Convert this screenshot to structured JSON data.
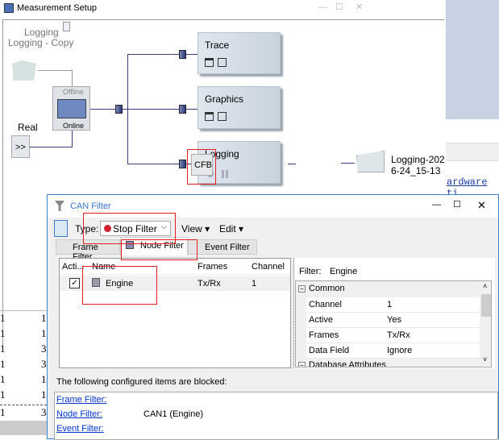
{
  "main_window": {
    "title": "Measurement Setup",
    "controls": [
      "—",
      "☐",
      "✕"
    ]
  },
  "diagram": {
    "source_labels": [
      "Logging",
      "Logging - Copy"
    ],
    "switch": {
      "top": "Offline",
      "bottom": "Online"
    },
    "real": {
      "label": "Real",
      "button": ">>"
    },
    "blocks": [
      {
        "title": "Trace"
      },
      {
        "title": "Graphics"
      },
      {
        "title": "Logging"
      }
    ],
    "cfb": "CFB",
    "output_file": [
      "Logging-202",
      "6-24_15-13"
    ]
  },
  "right_panel": {
    "code_text": "ardware ti"
  },
  "left_table": {
    "rows": [
      [
        "1",
        "1"
      ],
      [
        "1",
        "1"
      ],
      [
        "1",
        "3"
      ],
      [
        "1",
        "3"
      ],
      [
        "1",
        "1"
      ],
      [
        "1",
        "1"
      ],
      [
        "1",
        "3"
      ]
    ]
  },
  "dialog": {
    "title": "CAN Filter",
    "controls": [
      "—",
      "☐",
      "✕"
    ],
    "toolbar": {
      "type_label": "Type:",
      "type_value": "Stop Filter",
      "view": "View",
      "edit": "Edit"
    },
    "tabs": [
      {
        "label": "Frame Filter"
      },
      {
        "label": "Node Filter",
        "active": true
      },
      {
        "label": "Event Filter"
      }
    ],
    "list": {
      "columns": [
        "Acti...",
        "Name",
        "Frames",
        "Channel"
      ],
      "rows": [
        {
          "active": true,
          "name": "Engine",
          "frames": "Tx/Rx",
          "channel": "1"
        }
      ]
    },
    "properties": {
      "filter_label": "Filter:",
      "filter_value": "Engine",
      "groups": [
        {
          "name": "Common",
          "rows": [
            [
              "Channel",
              "1"
            ],
            [
              "Active",
              "Yes"
            ],
            [
              "Frames",
              "Tx/Rx"
            ],
            [
              "Data Field",
              "Ignore"
            ]
          ]
        },
        {
          "name": "Database Attributes"
        }
      ]
    },
    "blocked": {
      "heading": "The following configured items are blocked:",
      "items": [
        {
          "link": "Frame Filter:",
          "value": ""
        },
        {
          "link": "Node Filter:",
          "value": "CAN1 (Engine)"
        },
        {
          "link": "Event Filter:",
          "value": ""
        }
      ]
    }
  },
  "colors": {
    "accent": "#3c3c7c",
    "highlight": "#e02020",
    "link": "#0033cc"
  }
}
